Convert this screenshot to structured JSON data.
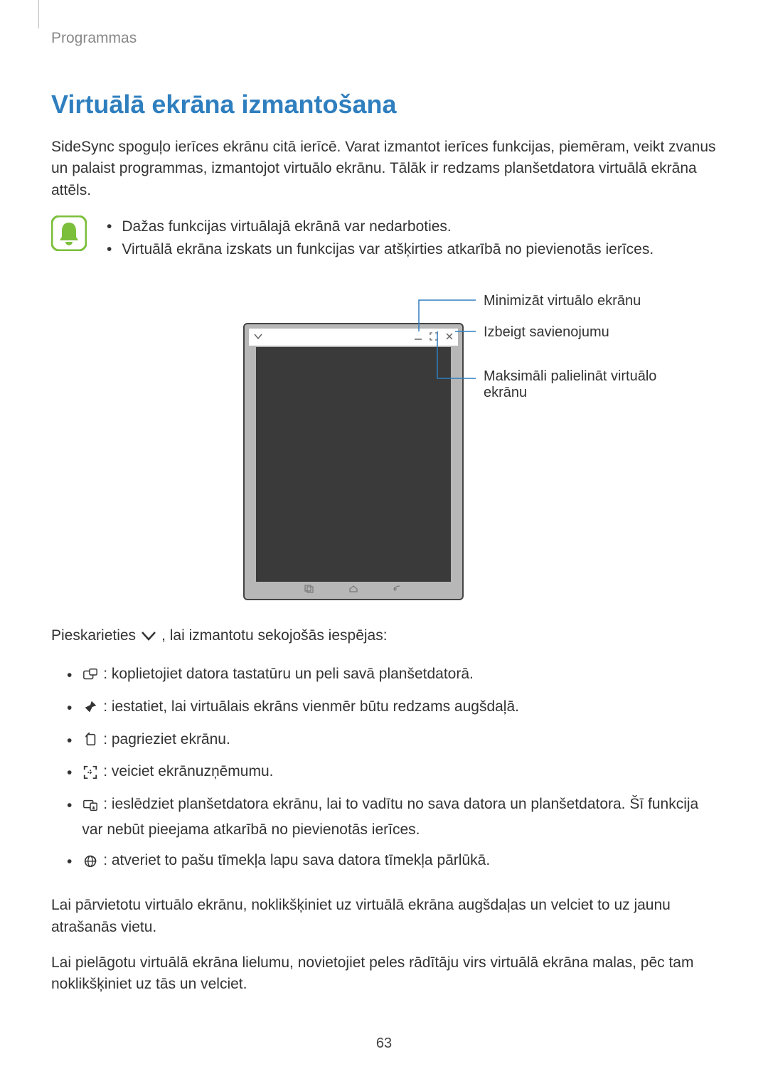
{
  "header": {
    "crumb": "Programmas"
  },
  "title": "Virtuālā ekrāna izmantošana",
  "intro": "SideSync spoguļo ierīces ekrānu citā ierīcē. Varat izmantot ierīces funkcijas, piemēram, veikt zvanus un palaist programmas, izmantojot virtuālo ekrānu. Tālāk ir redzams planšetdatora virtuālā ekrāna attēls.",
  "note": {
    "items": [
      "Dažas funkcijas virtuālajā ekrānā var nedarboties.",
      "Virtuālā ekrāna izskats un funkcijas var atšķirties atkarībā no pievienotās ierīces."
    ]
  },
  "callouts": {
    "minimize": "Minimizāt virtuālo ekrānu",
    "close": "Izbeigt savienojumu",
    "maximize": "Maksimāli palielināt virtuālo ekrānu"
  },
  "opts_intro_pre": "Pieskarieties ",
  "opts_intro_post": ", lai izmantotu sekojošās iespējas:",
  "opts": [
    {
      "icon": "keyboard-share-icon",
      "text": ": koplietojiet datora tastatūru un peli savā planšetdatorā."
    },
    {
      "icon": "pin-icon",
      "text": ": iestatiet, lai virtuālais ekrāns vienmēr būtu redzams augšdaļā."
    },
    {
      "icon": "rotate-icon",
      "text": ": pagrieziet ekrānu."
    },
    {
      "icon": "screenshot-icon",
      "text": ": veiciet ekrānuzņēmumu."
    },
    {
      "icon": "dual-screen-icon",
      "text": ": ieslēdziet planšetdatora ekrānu, lai to vadītu no sava datora un planšetdatora. Šī funkcija var nebūt pieejama atkarībā no pievienotās ierīces."
    },
    {
      "icon": "browser-sync-icon",
      "text": ": atveriet to pašu tīmekļa lapu sava datora tīmekļa pārlūkā."
    }
  ],
  "para_move": "Lai pārvietotu virtuālo ekrānu, noklikšķiniet uz virtuālā ekrāna augšdaļas un velciet to uz jaunu atrašanās vietu.",
  "para_resize": "Lai pielāgotu virtuālā ekrāna lielumu, novietojiet peles rādītāju virs virtuālā ekrāna malas, pēc tam noklikšķiniet uz tās un velciet.",
  "page_number": "63"
}
